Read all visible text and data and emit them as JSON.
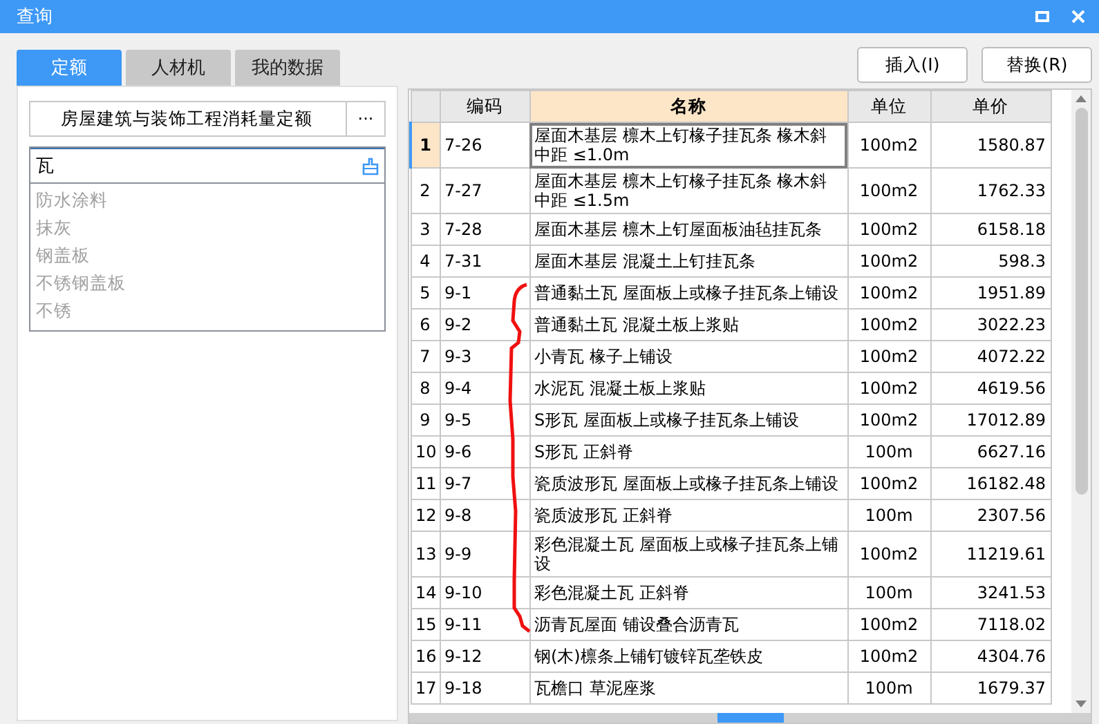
{
  "window": {
    "title": "查询"
  },
  "tabs": [
    {
      "label": "定额",
      "selected": true
    },
    {
      "label": "人材机",
      "selected": false
    },
    {
      "label": "我的数据",
      "selected": false
    }
  ],
  "actions": [
    "插入(I)",
    "替换(R)"
  ],
  "library": {
    "value": "房屋建筑与装饰工程消耗量定额",
    "button": "···"
  },
  "search": {
    "value": "瓦",
    "history": [
      "防水涂料",
      "抹灰",
      "钢盖板",
      "不锈钢盖板",
      "不锈"
    ]
  },
  "table": {
    "columns": [
      "编码",
      "名称",
      "单位",
      "单价"
    ],
    "rows": [
      {
        "index": "1",
        "code": "7-26",
        "name": "屋面木基层 檩木上钉椽子挂瓦条 椽木斜中距 ≤1.0m",
        "unit": "100m2",
        "price": "1580.87",
        "selected": true
      },
      {
        "index": "2",
        "code": "7-27",
        "name": "屋面木基层 檩木上钉椽子挂瓦条 椽木斜中距 ≤1.5m",
        "unit": "100m2",
        "price": "1762.33",
        "selected": false
      },
      {
        "index": "3",
        "code": "7-28",
        "name": "屋面木基层 檩木上钉屋面板油毡挂瓦条",
        "unit": "100m2",
        "price": "6158.18",
        "selected": false
      },
      {
        "index": "4",
        "code": "7-31",
        "name": "屋面木基层 混凝土上钉挂瓦条",
        "unit": "100m2",
        "price": "598.3",
        "selected": false
      },
      {
        "index": "5",
        "code": "9-1",
        "name": "普通黏土瓦 屋面板上或椽子挂瓦条上铺设",
        "unit": "100m2",
        "price": "1951.89",
        "selected": false
      },
      {
        "index": "6",
        "code": "9-2",
        "name": "普通黏土瓦 混凝土板上浆贴",
        "unit": "100m2",
        "price": "3022.23",
        "selected": false
      },
      {
        "index": "7",
        "code": "9-3",
        "name": "小青瓦 椽子上铺设",
        "unit": "100m2",
        "price": "4072.22",
        "selected": false
      },
      {
        "index": "8",
        "code": "9-4",
        "name": "水泥瓦 混凝土板上浆贴",
        "unit": "100m2",
        "price": "4619.56",
        "selected": false
      },
      {
        "index": "9",
        "code": "9-5",
        "name": "S形瓦 屋面板上或椽子挂瓦条上铺设",
        "unit": "100m2",
        "price": "17012.89",
        "selected": false
      },
      {
        "index": "10",
        "code": "9-6",
        "name": "S形瓦 正斜脊",
        "unit": "100m",
        "price": "6627.16",
        "selected": false
      },
      {
        "index": "11",
        "code": "9-7",
        "name": "瓷质波形瓦 屋面板上或椽子挂瓦条上铺设",
        "unit": "100m2",
        "price": "16182.48",
        "selected": false
      },
      {
        "index": "12",
        "code": "9-8",
        "name": "瓷质波形瓦 正斜脊",
        "unit": "100m",
        "price": "2307.56",
        "selected": false
      },
      {
        "index": "13",
        "code": "9-9",
        "name": "彩色混凝土瓦 屋面板上或椽子挂瓦条上铺设",
        "unit": "100m2",
        "price": "11219.61",
        "selected": false
      },
      {
        "index": "14",
        "code": "9-10",
        "name": "彩色混凝土瓦 正斜脊",
        "unit": "100m",
        "price": "3241.53",
        "selected": false
      },
      {
        "index": "15",
        "code": "9-11",
        "name": "沥青瓦屋面 铺设叠合沥青瓦",
        "unit": "100m2",
        "price": "7118.02",
        "selected": false
      },
      {
        "index": "16",
        "code": "9-12",
        "name": "钢(木)檩条上铺钉镀锌瓦垄铁皮",
        "unit": "100m2",
        "price": "4304.76",
        "selected": false
      },
      {
        "index": "17",
        "code": "9-18",
        "name": "瓦檐口 草泥座浆",
        "unit": "100m",
        "price": "1679.37",
        "selected": false
      }
    ]
  }
}
